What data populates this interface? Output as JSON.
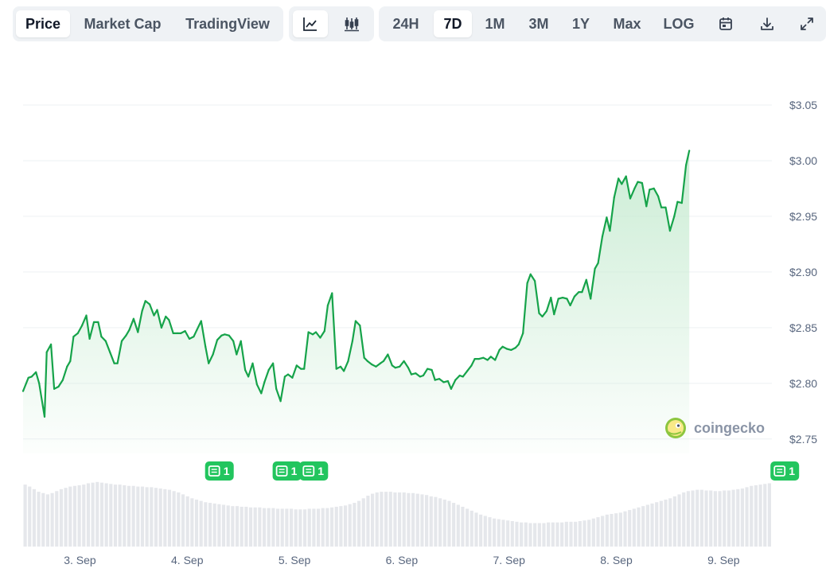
{
  "toolbar": {
    "data_tabs": [
      "Price",
      "Market Cap",
      "TradingView"
    ],
    "active_data_tab": "Price",
    "chart_type_icons": [
      "line-chart-icon",
      "candlestick-icon"
    ],
    "active_chart_type": "line-chart-icon",
    "ranges": [
      "24H",
      "7D",
      "1M",
      "3M",
      "1Y",
      "Max",
      "LOG"
    ],
    "active_range": "7D",
    "utility_icons": [
      "calendar-icon",
      "download-icon",
      "expand-icon"
    ]
  },
  "watermark": {
    "text": "coingecko"
  },
  "colors": {
    "line": "#16a34a",
    "area_top": "#c9ecd3",
    "volume": "#e5e7eb",
    "badge": "#22c55e",
    "grid": "#eef0f3"
  },
  "news_badges": [
    {
      "label": "1",
      "x": 4.3
    },
    {
      "label": "1",
      "x": 4.93
    },
    {
      "label": "1",
      "x": 5.18
    },
    {
      "label": "1",
      "x": 9.57
    }
  ],
  "chart_data": {
    "type": "area",
    "title": "",
    "xlabel": "",
    "ylabel": "",
    "x_unit": "days (September)",
    "x_range": [
      2.47,
      9.45
    ],
    "ylim": [
      2.737,
      3.06
    ],
    "y_ticks": [
      2.75,
      2.8,
      2.85,
      2.9,
      2.95,
      3.0,
      3.05
    ],
    "y_tick_labels": [
      "$2.75",
      "$2.80",
      "$2.85",
      "$2.90",
      "$2.95",
      "$3.00",
      "$3.05"
    ],
    "x_ticks": [
      3,
      4,
      5,
      6,
      7,
      8,
      9
    ],
    "x_tick_labels": [
      "3. Sep",
      "4. Sep",
      "5. Sep",
      "6. Sep",
      "7. Sep",
      "8. Sep",
      "9. Sep"
    ],
    "y_axis_position": "right",
    "grid": true,
    "series": [
      {
        "values": [
          [
            2.47,
            2.793
          ],
          [
            2.52,
            2.805
          ],
          [
            2.55,
            2.806
          ],
          [
            2.59,
            2.81
          ],
          [
            2.62,
            2.8
          ],
          [
            2.67,
            2.77
          ],
          [
            2.69,
            2.828
          ],
          [
            2.73,
            2.835
          ],
          [
            2.76,
            2.795
          ],
          [
            2.8,
            2.797
          ],
          [
            2.84,
            2.803
          ],
          [
            2.88,
            2.815
          ],
          [
            2.91,
            2.82
          ],
          [
            2.94,
            2.842
          ],
          [
            2.98,
            2.845
          ],
          [
            3.02,
            2.852
          ],
          [
            3.06,
            2.861
          ],
          [
            3.09,
            2.84
          ],
          [
            3.13,
            2.855
          ],
          [
            3.17,
            2.855
          ],
          [
            3.2,
            2.842
          ],
          [
            3.24,
            2.838
          ],
          [
            3.28,
            2.828
          ],
          [
            3.32,
            2.818
          ],
          [
            3.35,
            2.818
          ],
          [
            3.39,
            2.838
          ],
          [
            3.43,
            2.843
          ],
          [
            3.46,
            2.848
          ],
          [
            3.5,
            2.858
          ],
          [
            3.54,
            2.846
          ],
          [
            3.58,
            2.865
          ],
          [
            3.61,
            2.874
          ],
          [
            3.65,
            2.871
          ],
          [
            3.69,
            2.861
          ],
          [
            3.72,
            2.866
          ],
          [
            3.76,
            2.85
          ],
          [
            3.8,
            2.86
          ],
          [
            3.83,
            2.857
          ],
          [
            3.87,
            2.845
          ],
          [
            3.91,
            2.845
          ],
          [
            3.94,
            2.845
          ],
          [
            3.98,
            2.847
          ],
          [
            4.02,
            2.84
          ],
          [
            4.06,
            2.842
          ],
          [
            4.09,
            2.848
          ],
          [
            4.13,
            2.856
          ],
          [
            4.17,
            2.833
          ],
          [
            4.2,
            2.818
          ],
          [
            4.24,
            2.826
          ],
          [
            4.28,
            2.839
          ],
          [
            4.32,
            2.843
          ],
          [
            4.35,
            2.844
          ],
          [
            4.39,
            2.843
          ],
          [
            4.43,
            2.838
          ],
          [
            4.46,
            2.826
          ],
          [
            4.5,
            2.838
          ],
          [
            4.54,
            2.812
          ],
          [
            4.57,
            2.806
          ],
          [
            4.61,
            2.818
          ],
          [
            4.65,
            2.799
          ],
          [
            4.69,
            2.791
          ],
          [
            4.72,
            2.801
          ],
          [
            4.76,
            2.812
          ],
          [
            4.8,
            2.818
          ],
          [
            4.83,
            2.795
          ],
          [
            4.87,
            2.784
          ],
          [
            4.91,
            2.806
          ],
          [
            4.94,
            2.808
          ],
          [
            4.98,
            2.805
          ],
          [
            5.02,
            2.816
          ],
          [
            5.06,
            2.813
          ],
          [
            5.09,
            2.813
          ],
          [
            5.13,
            2.846
          ],
          [
            5.17,
            2.844
          ],
          [
            5.2,
            2.846
          ],
          [
            5.24,
            2.841
          ],
          [
            5.28,
            2.847
          ],
          [
            5.31,
            2.87
          ],
          [
            5.35,
            2.881
          ],
          [
            5.39,
            2.813
          ],
          [
            5.43,
            2.815
          ],
          [
            5.46,
            2.811
          ],
          [
            5.5,
            2.82
          ],
          [
            5.54,
            2.838
          ],
          [
            5.57,
            2.856
          ],
          [
            5.61,
            2.852
          ],
          [
            5.65,
            2.823
          ],
          [
            5.68,
            2.82
          ],
          [
            5.72,
            2.817
          ],
          [
            5.76,
            2.815
          ],
          [
            5.8,
            2.818
          ],
          [
            5.83,
            2.82
          ],
          [
            5.87,
            2.826
          ],
          [
            5.91,
            2.816
          ],
          [
            5.94,
            2.814
          ],
          [
            5.98,
            2.815
          ],
          [
            6.02,
            2.82
          ],
          [
            6.06,
            2.814
          ],
          [
            6.09,
            2.808
          ],
          [
            6.13,
            2.809
          ],
          [
            6.17,
            2.806
          ],
          [
            6.2,
            2.807
          ],
          [
            6.24,
            2.813
          ],
          [
            6.28,
            2.812
          ],
          [
            6.31,
            2.803
          ],
          [
            6.35,
            2.804
          ],
          [
            6.39,
            2.801
          ],
          [
            6.43,
            2.802
          ],
          [
            6.46,
            2.795
          ],
          [
            6.5,
            2.803
          ],
          [
            6.54,
            2.807
          ],
          [
            6.57,
            2.806
          ],
          [
            6.61,
            2.811
          ],
          [
            6.65,
            2.816
          ],
          [
            6.68,
            2.822
          ],
          [
            6.72,
            2.822
          ],
          [
            6.76,
            2.823
          ],
          [
            6.8,
            2.821
          ],
          [
            6.83,
            2.824
          ],
          [
            6.87,
            2.821
          ],
          [
            6.91,
            2.83
          ],
          [
            6.94,
            2.833
          ],
          [
            6.98,
            2.831
          ],
          [
            7.02,
            2.83
          ],
          [
            7.06,
            2.832
          ],
          [
            7.09,
            2.835
          ],
          [
            7.13,
            2.845
          ],
          [
            7.17,
            2.89
          ],
          [
            7.2,
            2.898
          ],
          [
            7.24,
            2.892
          ],
          [
            7.28,
            2.863
          ],
          [
            7.31,
            2.86
          ],
          [
            7.35,
            2.865
          ],
          [
            7.39,
            2.877
          ],
          [
            7.42,
            2.862
          ],
          [
            7.46,
            2.876
          ],
          [
            7.5,
            2.877
          ],
          [
            7.54,
            2.876
          ],
          [
            7.57,
            2.87
          ],
          [
            7.61,
            2.878
          ],
          [
            7.65,
            2.882
          ],
          [
            7.68,
            2.882
          ],
          [
            7.72,
            2.893
          ],
          [
            7.76,
            2.876
          ],
          [
            7.8,
            2.903
          ],
          [
            7.83,
            2.908
          ],
          [
            7.87,
            2.932
          ],
          [
            7.91,
            2.949
          ],
          [
            7.94,
            2.937
          ],
          [
            7.98,
            2.967
          ],
          [
            8.02,
            2.984
          ],
          [
            8.05,
            2.979
          ],
          [
            8.09,
            2.986
          ],
          [
            8.13,
            2.966
          ],
          [
            8.17,
            2.975
          ],
          [
            8.2,
            2.981
          ],
          [
            8.24,
            2.98
          ],
          [
            8.28,
            2.959
          ],
          [
            8.31,
            2.974
          ],
          [
            8.35,
            2.975
          ],
          [
            8.39,
            2.968
          ],
          [
            8.42,
            2.958
          ],
          [
            8.46,
            2.958
          ],
          [
            8.5,
            2.937
          ],
          [
            8.54,
            2.95
          ],
          [
            8.57,
            2.963
          ],
          [
            8.61,
            2.962
          ],
          [
            8.65,
            2.996
          ],
          [
            8.68,
            3.009
          ]
        ]
      }
    ],
    "volume": [
      0.95,
      0.92,
      0.88,
      0.84,
      0.82,
      0.8,
      0.82,
      0.85,
      0.88,
      0.9,
      0.92,
      0.93,
      0.94,
      0.95,
      0.97,
      0.98,
      0.99,
      0.98,
      0.97,
      0.96,
      0.95,
      0.95,
      0.94,
      0.93,
      0.93,
      0.92,
      0.92,
      0.91,
      0.91,
      0.9,
      0.89,
      0.88,
      0.87,
      0.85,
      0.83,
      0.8,
      0.77,
      0.74,
      0.72,
      0.7,
      0.68,
      0.67,
      0.66,
      0.65,
      0.64,
      0.63,
      0.62,
      0.62,
      0.61,
      0.61,
      0.6,
      0.6,
      0.6,
      0.59,
      0.59,
      0.59,
      0.58,
      0.58,
      0.58,
      0.58,
      0.57,
      0.57,
      0.57,
      0.58,
      0.58,
      0.58,
      0.59,
      0.59,
      0.6,
      0.61,
      0.62,
      0.63,
      0.65,
      0.67,
      0.7,
      0.74,
      0.78,
      0.81,
      0.83,
      0.84,
      0.84,
      0.84,
      0.83,
      0.83,
      0.83,
      0.82,
      0.82,
      0.81,
      0.8,
      0.79,
      0.77,
      0.76,
      0.74,
      0.72,
      0.7,
      0.67,
      0.64,
      0.61,
      0.58,
      0.55,
      0.52,
      0.49,
      0.47,
      0.45,
      0.43,
      0.42,
      0.41,
      0.4,
      0.39,
      0.38,
      0.37,
      0.37,
      0.36,
      0.36,
      0.36,
      0.36,
      0.37,
      0.37,
      0.37,
      0.37,
      0.38,
      0.38,
      0.38,
      0.39,
      0.4,
      0.41,
      0.43,
      0.45,
      0.47,
      0.49,
      0.5,
      0.51,
      0.52,
      0.54,
      0.56,
      0.58,
      0.6,
      0.62,
      0.64,
      0.66,
      0.68,
      0.7,
      0.72,
      0.74,
      0.77,
      0.8,
      0.83,
      0.85,
      0.86,
      0.87,
      0.87,
      0.86,
      0.86,
      0.85,
      0.85,
      0.86,
      0.86,
      0.87,
      0.88,
      0.89,
      0.91,
      0.93,
      0.94,
      0.95,
      0.96,
      0.97
    ]
  }
}
